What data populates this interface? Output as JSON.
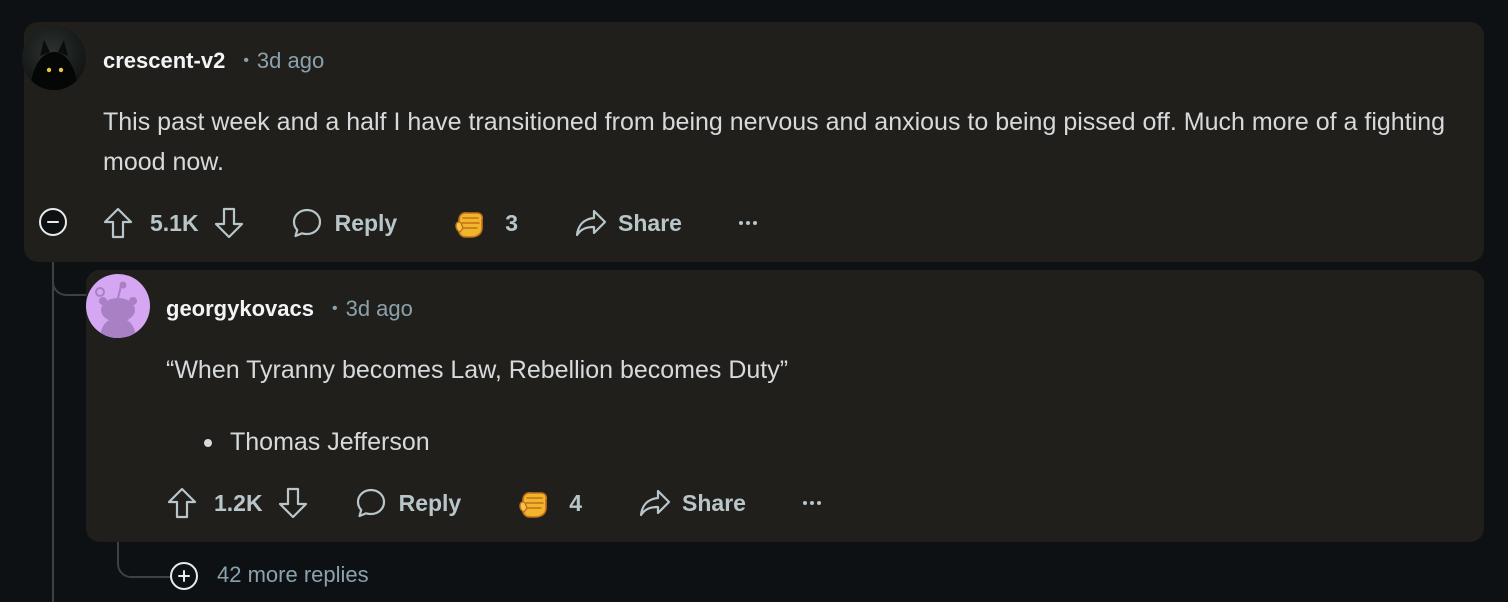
{
  "comments": [
    {
      "username": "crescent-v2",
      "separator": "•",
      "time": "3d ago",
      "body": "This past week and a half I have transitioned from being nervous and anxious to being pissed off. Much more of a fighting mood now.",
      "votes": "5.1K",
      "reply_label": "Reply",
      "award_count": "3",
      "share_label": "Share",
      "more_label": "•••",
      "avatar_icon": "dark-creature-avatar"
    },
    {
      "username": "georgykovacs",
      "separator": "•",
      "time": "3d ago",
      "quote": "“When Tyranny becomes Law, Rebellion becomes Duty”",
      "bullet": "Thomas Jefferson",
      "votes": "1.2K",
      "reply_label": "Reply",
      "award_count": "4",
      "share_label": "Share",
      "more_label": "•••",
      "avatar_icon": "snoo-avatar"
    }
  ],
  "more_replies_label": "42 more replies",
  "colors": {
    "background": "#0e1113",
    "card": "#201f1b",
    "thread_highlight": "#c9a227",
    "thread_line": "#3e4142",
    "avatar_2": "#d5a6f2"
  }
}
